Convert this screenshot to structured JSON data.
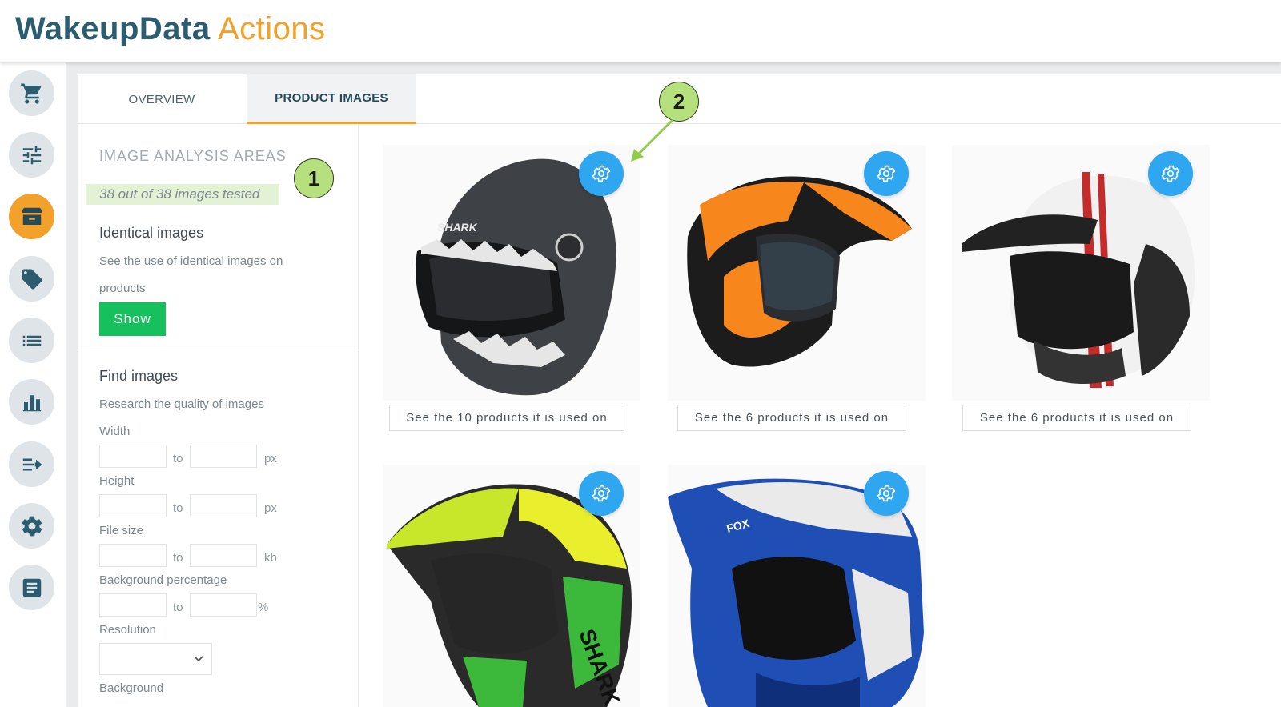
{
  "app": {
    "logo_part1": "WakeupData",
    "logo_part2": "Actions"
  },
  "sidebar": {
    "items": [
      {
        "icon": "cart-icon"
      },
      {
        "icon": "sliders-icon"
      },
      {
        "icon": "box-icon",
        "active": true
      },
      {
        "icon": "tag-icon"
      },
      {
        "icon": "list-icon"
      },
      {
        "icon": "bar-chart-icon"
      },
      {
        "icon": "export-icon"
      },
      {
        "icon": "gear-icon"
      },
      {
        "icon": "document-icon"
      }
    ]
  },
  "tabs": [
    {
      "label": "OVERVIEW"
    },
    {
      "label": "PRODUCT IMAGES",
      "active": true
    }
  ],
  "filters": {
    "section_title": "IMAGE ANALYSIS AREAS",
    "tested_text": "38 out of 38 images tested",
    "identical": {
      "title": "Identical images",
      "desc_line1": "See the use of identical images on",
      "desc_line2": "products",
      "button": "Show"
    },
    "find": {
      "title": "Find images",
      "desc": "Research the quality of images",
      "width_label": "Width",
      "height_label": "Height",
      "filesize_label": "File size",
      "bgpct_label": "Background percentage",
      "resolution_label": "Resolution",
      "background_label": "Background",
      "to": "to",
      "unit_px": "px",
      "unit_kb": "kb",
      "unit_pct": "%"
    }
  },
  "images": [
    {
      "button": "See the 10 products it is used on"
    },
    {
      "button": "See the 6 products it is used on"
    },
    {
      "button": "See the 6 products it is used on"
    },
    {
      "button": ""
    },
    {
      "button": ""
    }
  ],
  "callouts": [
    "1",
    "2"
  ],
  "colors": {
    "accent": "#f2a22b",
    "brand": "#2b5c70",
    "primary": "#2fa7f0",
    "success": "#16c05d"
  }
}
